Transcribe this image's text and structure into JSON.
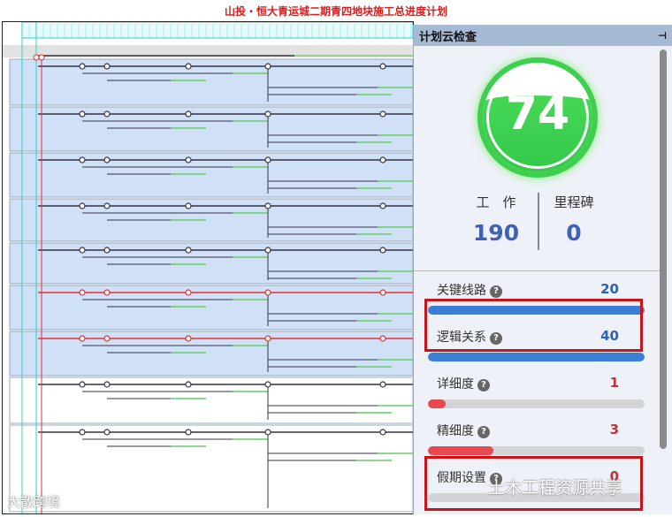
{
  "title": "山投・恒大青运城二期青四地块施工总进度计划",
  "panel": {
    "title": "计划云检查",
    "pin_icon": "pin-icon",
    "score": 74,
    "work_label": "工　作",
    "work_value": "190",
    "milestone_label": "里程碑",
    "milestone_value": "0",
    "metrics": [
      {
        "label": "关键线路",
        "value": "20",
        "percent": 100,
        "color": "#3a7fd5",
        "value_color": "#2f62b0"
      },
      {
        "label": "逻辑关系",
        "value": "40",
        "percent": 100,
        "color": "#3a7fd5",
        "value_color": "#2f62b0"
      },
      {
        "label": "详细度",
        "value": "1",
        "percent": 8,
        "color": "#e8484e",
        "value_color": "#c0303a"
      },
      {
        "label": "精细度",
        "value": "3",
        "percent": 30,
        "color": "#e8484e",
        "value_color": "#c0303a"
      },
      {
        "label": "假期设置",
        "value": "0",
        "percent": 0,
        "color": "#e8484e",
        "value_color": "#c0303a"
      }
    ]
  },
  "watermarks": {
    "left": "大散跨境",
    "right": "土木工程资源共享"
  }
}
